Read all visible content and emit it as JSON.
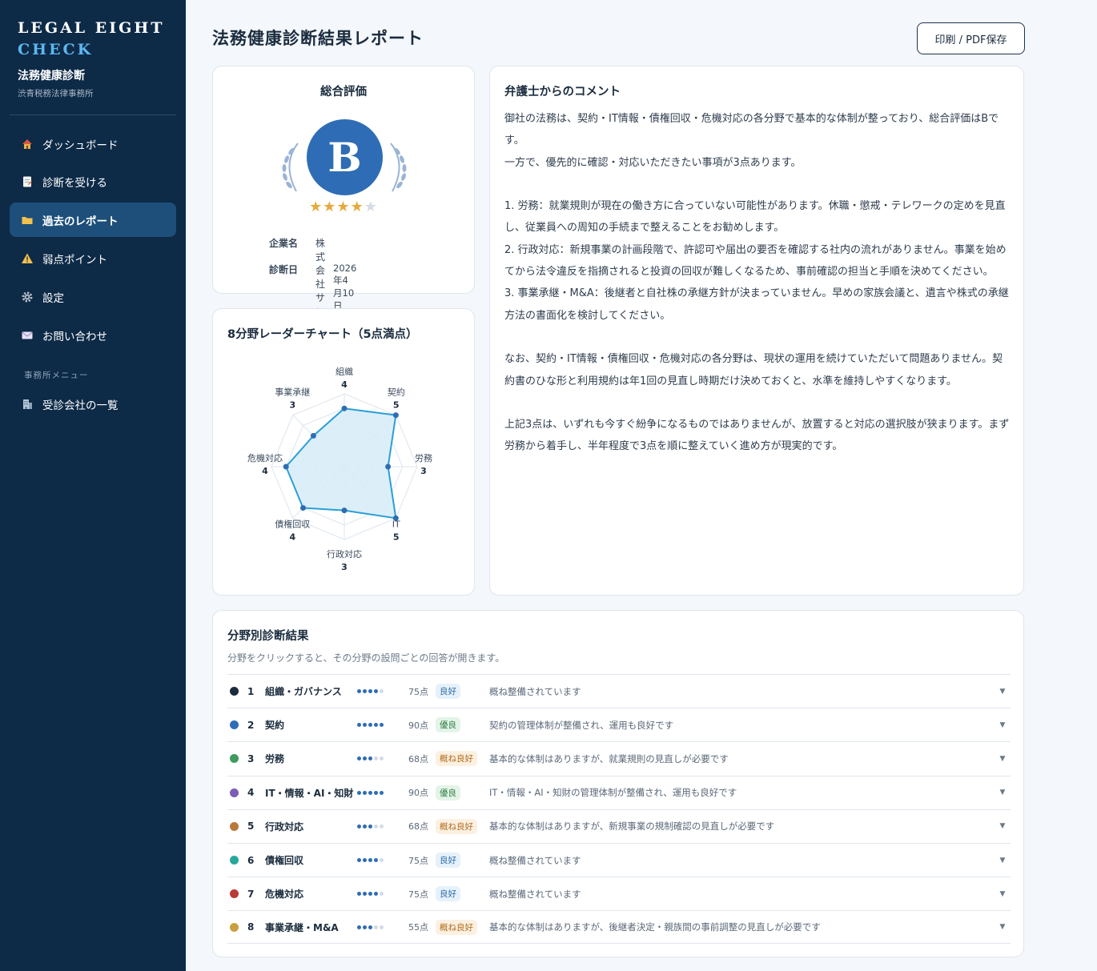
{
  "sidebar": {
    "brand_line1": "LEGAL EIGHT",
    "brand_line2": "CHECK",
    "subtitle": "法務健康診断",
    "office": "渋青税務法律事務所",
    "items": [
      {
        "label": "ダッシュボード",
        "icon": "house-icon"
      },
      {
        "label": "診断を受ける",
        "icon": "document-icon"
      },
      {
        "label": "過去のレポート",
        "icon": "folder-icon"
      },
      {
        "label": "弱点ポイント",
        "icon": "warning-icon"
      },
      {
        "label": "設定",
        "icon": "gear-icon"
      },
      {
        "label": "お問い合わせ",
        "icon": "envelope-icon"
      }
    ],
    "section_label": "事務所メニュー",
    "office_items": [
      {
        "label": "受診会社の一覧",
        "icon": "building-icon"
      }
    ]
  },
  "header": {
    "title": "法務健康診断結果レポート",
    "print_label": "印刷 / PDF保存"
  },
  "overall": {
    "title": "総合評価",
    "grade": "B",
    "stars": 4,
    "stars_max": 5,
    "company_label": "企業名",
    "company": "株式会社サンプル商事",
    "date_label": "診断日",
    "date": "2026年4月10日"
  },
  "radar": {
    "title": "8分野レーダーチャート（5点満点）"
  },
  "chart_data": {
    "type": "radar",
    "title": "8分野レーダーチャート（5点満点）",
    "max": 5,
    "axes": [
      {
        "label": "組織",
        "value": 4
      },
      {
        "label": "契約",
        "value": 5
      },
      {
        "label": "労務",
        "value": 3
      },
      {
        "label": "IT",
        "value": 5
      },
      {
        "label": "行政対応",
        "value": 3
      },
      {
        "label": "債権回収",
        "value": 4
      },
      {
        "label": "危機対応",
        "value": 4
      },
      {
        "label": "事業承継",
        "value": 3
      }
    ]
  },
  "comment": {
    "title": "弁護士からのコメント",
    "paragraphs": [
      "御社の法務は、契約・IT情報・債権回収・危機対応の各分野で基本的な体制が整っており、総合評価はBです。",
      "一方で、優先的に確認・対応いただきたい事項が3点あります。",
      "",
      "1. 労務：就業規則が現在の働き方に合っていない可能性があります。休職・懲戒・テレワークの定めを見直し、従業員への周知の手続まで整えることをお勧めします。",
      "2. 行政対応：新規事業の計画段階で、許認可や届出の要否を確認する社内の流れがありません。事業を始めてから法令違反を指摘されると投資の回収が難しくなるため、事前確認の担当と手順を決めてください。",
      "3. 事業承継・M&A：後継者と自社株の承継方針が決まっていません。早めの家族会議と、遺言や株式の承継方法の書面化を検討してください。",
      "",
      "なお、契約・IT情報・債権回収・危機対応の各分野は、現状の運用を続けていただいて問題ありません。契約書のひな形と利用規約は年1回の見直し時期だけ決めておくと、水準を維持しやすくなります。",
      "",
      "上記3点は、いずれも今すぐ紛争になるものではありませんが、放置すると対応の選択肢が狭まります。まず労務から着手し、半年程度で3点を順に整えていく進め方が現実的です。"
    ]
  },
  "results": {
    "title": "分野別診断結果",
    "subtitle": "分野をクリックすると、その分野の設問ごとの回答が開きます。",
    "rows": [
      {
        "num": "1",
        "name": "組織・ガバナンス",
        "color": "#1b2c3e",
        "level": 4,
        "score": "75点",
        "badge": "良好",
        "badge_type": "good",
        "desc": "概ね整備されています"
      },
      {
        "num": "2",
        "name": "契約",
        "color": "#2e6db5",
        "level": 5,
        "score": "90点",
        "badge": "優良",
        "badge_type": "excellent",
        "desc": "契約の管理体制が整備され、運用も良好です"
      },
      {
        "num": "3",
        "name": "労務",
        "color": "#3f9a5c",
        "level": 3,
        "score": "68点",
        "badge": "概ね良好",
        "badge_type": "fair",
        "desc": "基本的な体制はありますが、就業規則の見直しが必要です"
      },
      {
        "num": "4",
        "name": "IT・情報・AI・知財",
        "color": "#7b5cb8",
        "level": 5,
        "score": "90点",
        "badge": "優良",
        "badge_type": "excellent",
        "desc": "IT・情報・AI・知財の管理体制が整備され、運用も良好です"
      },
      {
        "num": "5",
        "name": "行政対応",
        "color": "#b87a3a",
        "level": 3,
        "score": "68点",
        "badge": "概ね良好",
        "badge_type": "fair",
        "desc": "基本的な体制はありますが、新規事業の規制確認の見直しが必要です"
      },
      {
        "num": "6",
        "name": "債権回収",
        "color": "#28a89c",
        "level": 4,
        "score": "75点",
        "badge": "良好",
        "badge_type": "good",
        "desc": "概ね整備されています"
      },
      {
        "num": "7",
        "name": "危機対応",
        "color": "#b93a35",
        "level": 4,
        "score": "75点",
        "badge": "良好",
        "badge_type": "good",
        "desc": "概ね整備されています"
      },
      {
        "num": "8",
        "name": "事業承継・M&A",
        "color": "#c9a040",
        "level": 3,
        "score": "55点",
        "badge": "概ね良好",
        "badge_type": "fair",
        "desc": "基本的な体制はありますが、後継者決定・親族間の事前調整の見直しが必要です"
      }
    ]
  },
  "colors": {
    "sidebar_bg": "#0d2a47",
    "accent": "#2e6db5",
    "brand_accent": "#5cb8ef",
    "radar_fill": "#d6ecf8",
    "radar_stroke": "#2a9fd6",
    "star": "#e6a93a"
  }
}
